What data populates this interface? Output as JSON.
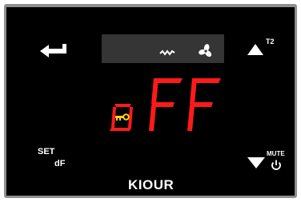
{
  "colors": {
    "bezel": "#8e8e8e",
    "panel": "#000000",
    "status_strip": "#353535",
    "display_red": "#ff1a1a",
    "key_yellow": "#ffd21a",
    "icon_white": "#ffffff"
  },
  "buttons": {
    "enter": {
      "icon": "enter-arrow-icon"
    },
    "up": {
      "icon": "up-triangle-icon",
      "label": "T2"
    },
    "set": {
      "label": "SET",
      "sublabel": "dF"
    },
    "down": {
      "icon": "down-triangle-icon",
      "label": "MUTE",
      "secondary_icon": "power-icon"
    }
  },
  "status_icons": [
    "defrost-wave-icon",
    "fan-icon"
  ],
  "display": {
    "digits": [
      "o",
      "F",
      "F"
    ],
    "indicator_icon": "key-icon"
  },
  "brand": "KIOUR"
}
